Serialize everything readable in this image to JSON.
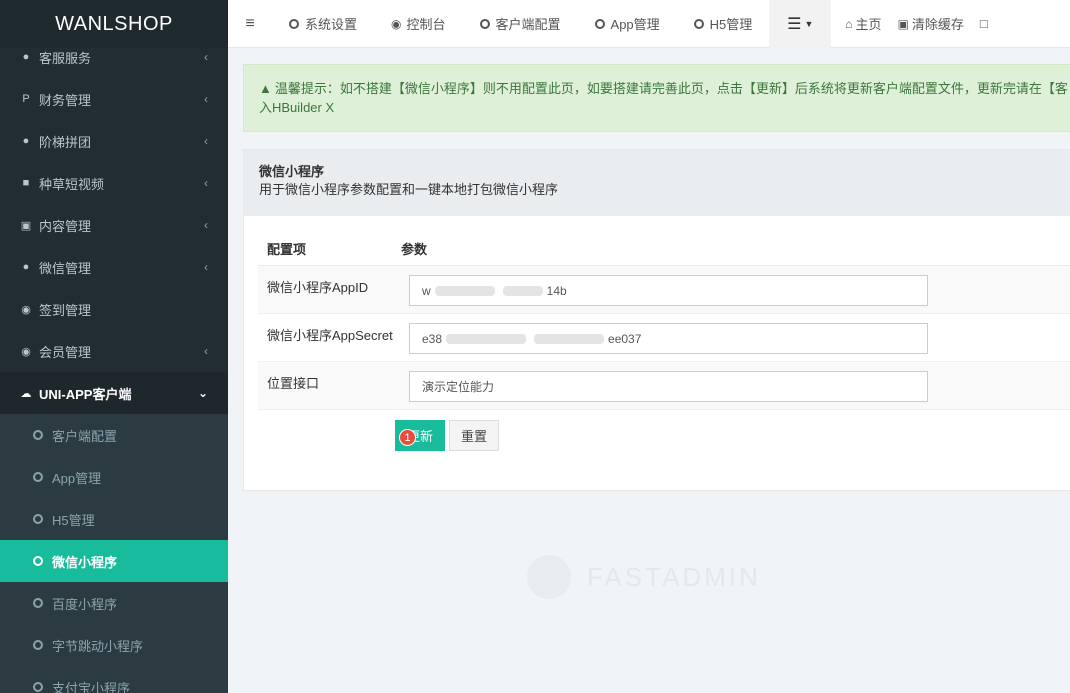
{
  "brand": "WANLSHOP",
  "sidebar": {
    "items": [
      {
        "label": "客服服务",
        "icon": "comments-icon"
      },
      {
        "label": "财务管理",
        "icon": "paypal-icon"
      },
      {
        "label": "阶梯拼团",
        "icon": "users-icon"
      },
      {
        "label": "种草短视频",
        "icon": "video-icon"
      },
      {
        "label": "内容管理",
        "icon": "edit-icon"
      },
      {
        "label": "微信管理",
        "icon": "wechat-icon"
      },
      {
        "label": "签到管理",
        "icon": "map-marker-icon"
      },
      {
        "label": "会员管理",
        "icon": "user-circle-icon"
      },
      {
        "label": "UNI-APP客户端",
        "icon": "cloud-icon"
      }
    ],
    "subitems": [
      {
        "label": "客户端配置"
      },
      {
        "label": "App管理"
      },
      {
        "label": "H5管理"
      },
      {
        "label": "微信小程序"
      },
      {
        "label": "百度小程序"
      },
      {
        "label": "字节跳动小程序"
      },
      {
        "label": "支付宝小程序"
      }
    ]
  },
  "topnav": {
    "tabs": [
      {
        "label": "系统设置"
      },
      {
        "label": "控制台"
      },
      {
        "label": "客户端配置"
      },
      {
        "label": "App管理"
      },
      {
        "label": "H5管理"
      }
    ],
    "home": "主页",
    "clear_cache": "清除缓存"
  },
  "alert": {
    "text": "温馨提示：如不搭建【微信小程序】则不用配置此页，如要搭建请完善此页，点击【更新】后系统将更新客户端配置文件，更新完请在【客户端配置】中重新生成，并拷贝到uni-app源码导入HBuilder X",
    "line1": "温馨提示：如不搭建【微信小程序】则不用配置此页，如要搭建请完善此页，点击【更新】后系统将更新客户端配置文件，更新完请在【客",
    "line2": "入HBuilder X"
  },
  "panel": {
    "title": "微信小程序",
    "subtitle": "用于微信小程序参数配置和一键本地打包微信小程序"
  },
  "table": {
    "header_key": "配置项",
    "header_value": "参数",
    "rows": [
      {
        "label": "微信小程序AppID",
        "value_start": "w",
        "value_end": "14b"
      },
      {
        "label": "微信小程序AppSecret",
        "value_start": "e38",
        "value_end": "ee037"
      },
      {
        "label": "位置接口",
        "value": "演示定位能力"
      }
    ]
  },
  "buttons": {
    "update": "更新",
    "reset": "重置",
    "badge": "1"
  },
  "watermark": "FASTADMIN"
}
